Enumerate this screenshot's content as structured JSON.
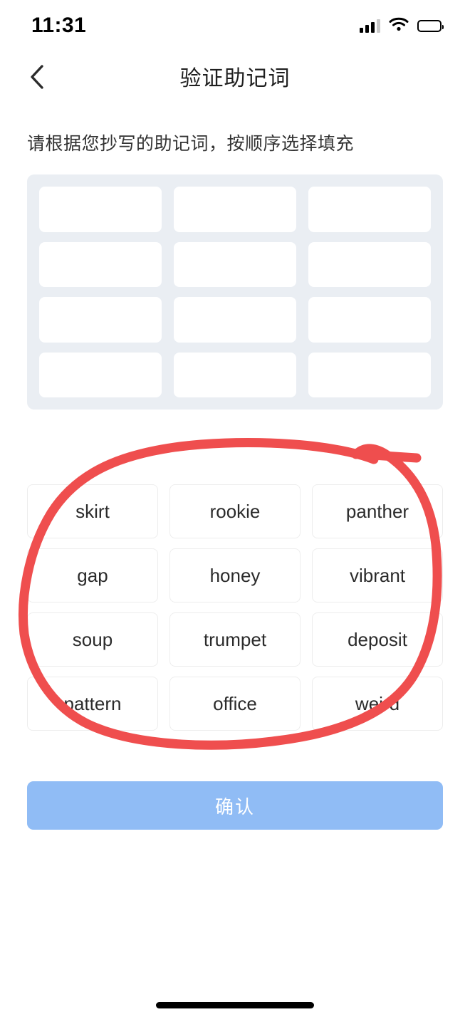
{
  "status_bar": {
    "time": "11:31",
    "signal_icon": "cellular-signal-icon",
    "wifi_icon": "wifi-icon",
    "battery_icon": "battery-full-icon"
  },
  "nav": {
    "back_icon": "chevron-left-icon",
    "title": "验证助记词"
  },
  "instruction": "请根据您抄写的助记词，按顺序选择填充",
  "slots": {
    "count": 12,
    "columns": 3,
    "rows": 4,
    "values": [
      "",
      "",
      "",
      "",
      "",
      "",
      "",
      "",
      "",
      "",
      "",
      ""
    ],
    "panel_color": "#eaeef3",
    "cell_color": "#ffffff"
  },
  "word_bank": {
    "words": [
      "skirt",
      "rookie",
      "panther",
      "gap",
      "honey",
      "vibrant",
      "soup",
      "trumpet",
      "deposit",
      "pattern",
      "office",
      "weird"
    ]
  },
  "annotation": {
    "type": "hand-drawn-circle",
    "color": "#ef4e4e",
    "stroke_width": 13,
    "target": "word-bank"
  },
  "confirm_button": {
    "label": "确认",
    "color": "#90bcf5",
    "text_color": "#ffffff"
  },
  "home_indicator": {
    "color": "#000000"
  }
}
